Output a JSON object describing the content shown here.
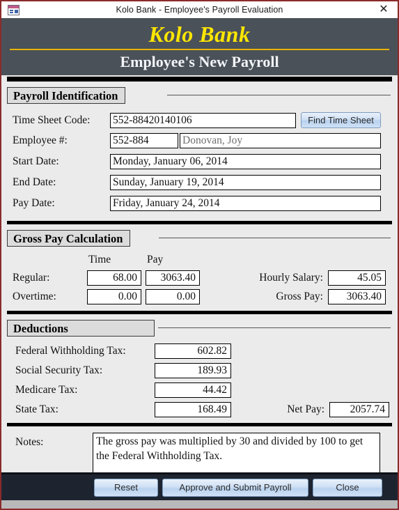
{
  "window": {
    "title": "Kolo Bank - Employee's Payroll Evaluation",
    "icon": "access-form-icon",
    "close_label": "✕"
  },
  "banner": {
    "brand": "Kolo Bank",
    "subtitle": "Employee's New Payroll",
    "brand_color": "#ffe600",
    "rule_color": "#e8b400",
    "background_color": "#4a5159"
  },
  "sections": {
    "identification": {
      "heading": "Payroll Identification",
      "time_sheet_code": {
        "label": "Time Sheet Code:",
        "value": "552-88420140106"
      },
      "find_button": {
        "label": "Find Time Sheet"
      },
      "employee_number": {
        "label": "Employee #:",
        "value": "552-884"
      },
      "employee_name": {
        "value": "Donovan, Joy"
      },
      "start_date": {
        "label": "Start Date:",
        "value": "Monday, January 06, 2014"
      },
      "end_date": {
        "label": "End Date:",
        "value": "Sunday, January 19, 2014"
      },
      "pay_date": {
        "label": "Pay Date:",
        "value": "Friday, January 24, 2014"
      }
    },
    "gross_pay": {
      "heading": "Gross Pay Calculation",
      "col_time": "Time",
      "col_pay": "Pay",
      "regular": {
        "label": "Regular:",
        "time": "68.00",
        "pay": "3063.40"
      },
      "overtime": {
        "label": "Overtime:",
        "time": "0.00",
        "pay": "0.00"
      },
      "hourly_salary": {
        "label": "Hourly Salary:",
        "value": "45.05"
      },
      "gross_pay_total": {
        "label": "Gross Pay:",
        "value": "3063.40"
      }
    },
    "deductions": {
      "heading": "Deductions",
      "federal": {
        "label": "Federal Withholding Tax:",
        "value": "602.82"
      },
      "social_security": {
        "label": "Social Security Tax:",
        "value": "189.93"
      },
      "medicare": {
        "label": "Medicare Tax:",
        "value": "44.42"
      },
      "state": {
        "label": "State Tax:",
        "value": "168.49"
      },
      "net_pay": {
        "label": "Net Pay:",
        "value": "2057.74"
      }
    },
    "notes": {
      "label": "Notes:",
      "value": "The gross pay was multiplied by 30 and divided by 100 to get the Federal Withholding Tax."
    }
  },
  "footer": {
    "reset_label": "Reset",
    "submit_label": "Approve and Submit Payroll",
    "close_label": "Close"
  }
}
